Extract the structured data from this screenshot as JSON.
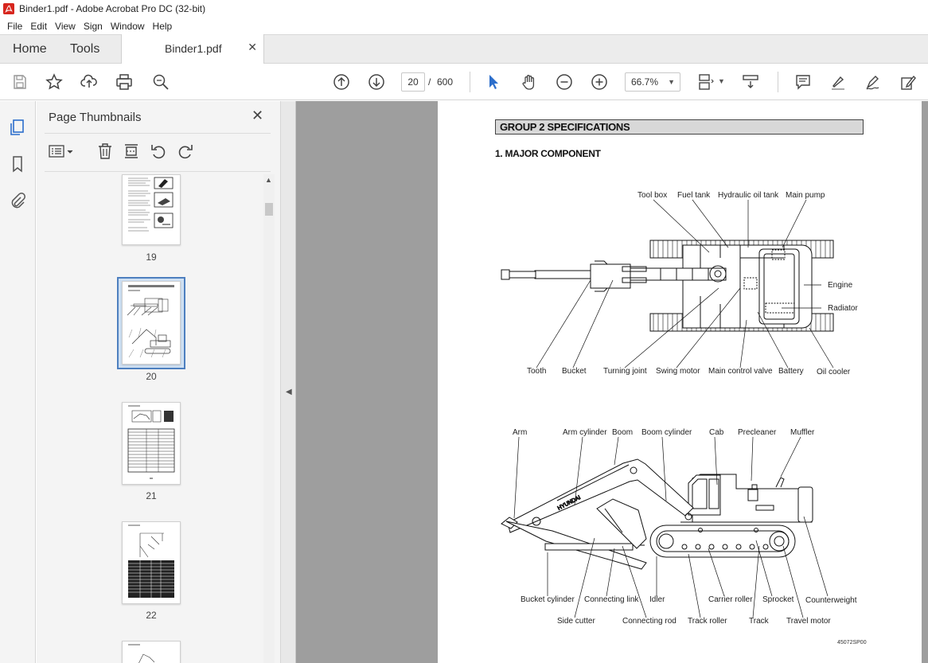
{
  "window": {
    "title": "Binder1.pdf - Adobe Acrobat Pro DC (32-bit)"
  },
  "menu": [
    "File",
    "Edit",
    "View",
    "Sign",
    "Window",
    "Help"
  ],
  "tabs": {
    "home": "Home",
    "tools": "Tools",
    "file": "Binder1.pdf"
  },
  "toolbar": {
    "current_page": "20",
    "separator": "/",
    "total_pages": "600",
    "zoom": "66.7%"
  },
  "panel": {
    "title": "Page Thumbnails",
    "thumbnails": [
      {
        "page": "19"
      },
      {
        "page": "20",
        "selected": true
      },
      {
        "page": "21"
      },
      {
        "page": "22"
      }
    ]
  },
  "document": {
    "group_heading": "GROUP 2 SPECIFICATIONS",
    "section_heading": "1. MAJOR COMPONENT",
    "figure_code": "45072SP00",
    "top_view_labels": {
      "tool_box": "Tool box",
      "fuel_tank": "Fuel tank",
      "hydraulic_oil_tank": "Hydraulic oil tank",
      "main_pump": "Main pump",
      "engine": "Engine",
      "radiator": "Radiator",
      "tooth": "Tooth",
      "bucket": "Bucket",
      "turning_joint": "Turning joint",
      "swing_motor": "Swing motor",
      "main_control_valve": "Main control valve",
      "battery": "Battery",
      "oil_cooler": "Oil cooler"
    },
    "side_view_labels": {
      "arm": "Arm",
      "arm_cylinder": "Arm cylinder",
      "boom": "Boom",
      "boom_cylinder": "Boom cylinder",
      "cab": "Cab",
      "precleaner": "Precleaner",
      "muffler": "Muffler",
      "bucket_cylinder": "Bucket cylinder",
      "connecting_link": "Connecting link",
      "idler": "Idler",
      "carrier_roller": "Carrier roller",
      "sprocket": "Sprocket",
      "counterweight": "Counterweight",
      "side_cutter": "Side cutter",
      "connecting_rod": "Connecting rod",
      "track_roller": "Track roller",
      "track": "Track",
      "travel_motor": "Travel motor",
      "brand": "HYUNDAI"
    }
  },
  "colors": {
    "accent": "#2c6ecb",
    "toolbar_bg": "#ffffff",
    "tabbar_bg": "#ececec",
    "panel_bg": "#f4f4f4",
    "doc_bg": "#9e9e9e",
    "select_border": "#4d7fbf",
    "acrobat_red": "#d7261e"
  }
}
